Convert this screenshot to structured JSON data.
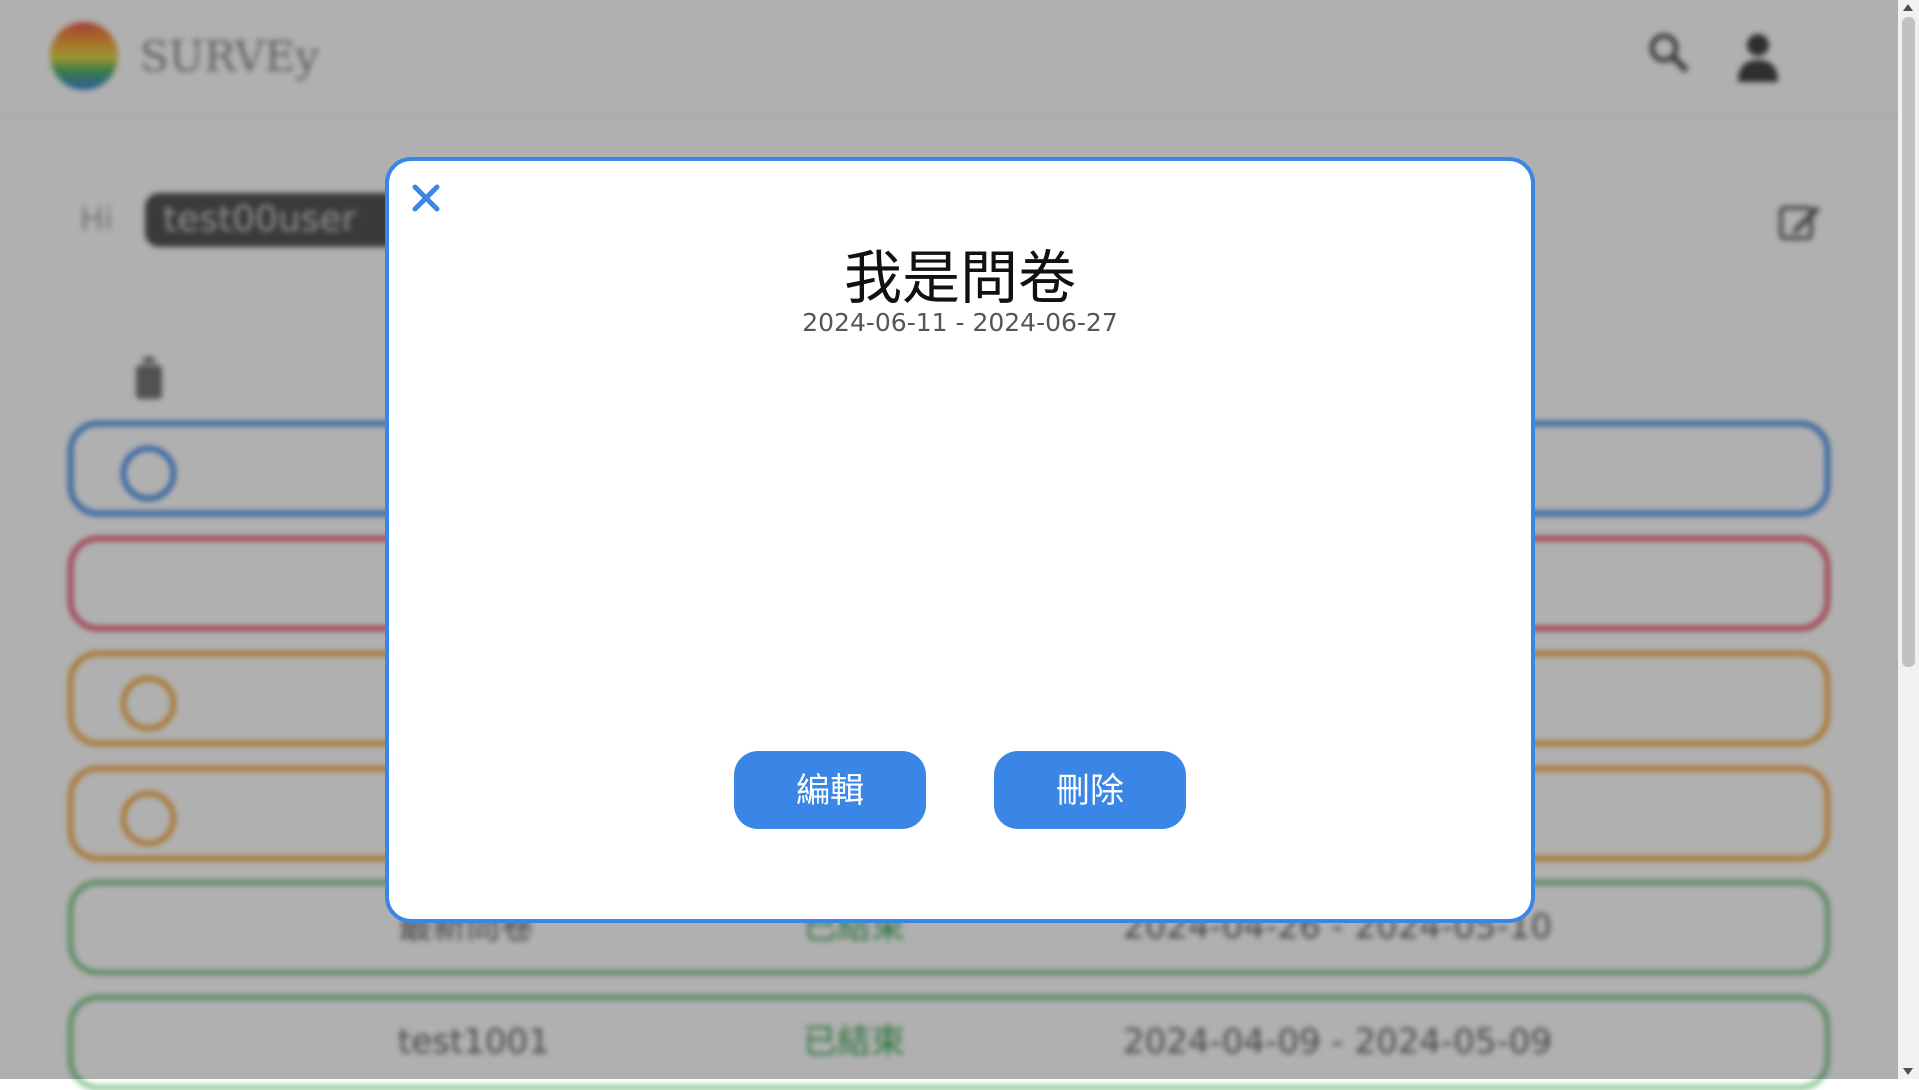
{
  "header": {
    "brand": "SURVEy",
    "search_icon": "search-icon",
    "user_icon": "user-icon"
  },
  "greeting": {
    "hi": "Hi",
    "username": "test00user"
  },
  "rows": [
    {
      "color": "#3a86e6",
      "has_circle": true,
      "name": "",
      "status": "",
      "dates": "",
      "status_color": "#3aa655"
    },
    {
      "color": "#e8556f",
      "has_circle": false,
      "name": "",
      "status": "",
      "dates": "",
      "status_color": "#3aa655"
    },
    {
      "color": "#f4a53b",
      "has_circle": true,
      "name": "",
      "status": "",
      "dates": "",
      "status_color": "#3aa655"
    },
    {
      "color": "#f4a53b",
      "has_circle": true,
      "name": "",
      "status": "",
      "dates": "",
      "status_color": "#3aa655"
    },
    {
      "color": "#7fc48a",
      "has_circle": false,
      "name": "最新問卷",
      "status": "已結束",
      "dates": "2024-04-26 - 2024-05-10",
      "status_color": "#3aa655"
    },
    {
      "color": "#7fc48a",
      "has_circle": false,
      "name": "test1001",
      "status": "已結束",
      "dates": "2024-04-09 - 2024-05-09",
      "status_color": "#3aa655"
    }
  ],
  "modal": {
    "title": "我是問卷",
    "dates": "2024-06-11 - 2024-06-27",
    "edit_label": "編輯",
    "delete_label": "刪除",
    "accent": "#3a86e6"
  }
}
